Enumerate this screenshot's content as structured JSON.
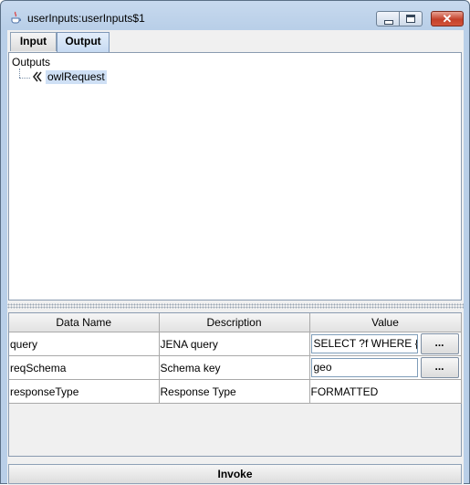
{
  "window": {
    "title": "userInputs:userInputs$1",
    "controls": {
      "minimize_icon": "minimize-icon",
      "maximize_icon": "maximize-icon",
      "close_icon": "close-icon",
      "close_glyph": "✕"
    }
  },
  "tabs": [
    {
      "label": "Input",
      "selected": false
    },
    {
      "label": "Output",
      "selected": true
    }
  ],
  "tree": {
    "root": "Outputs",
    "children": [
      {
        "label": "owlRequest",
        "icon": "service-node-icon",
        "selected": true
      }
    ]
  },
  "table": {
    "columns": [
      "Data Name",
      "Description",
      "Value"
    ],
    "rows": [
      {
        "name": "query",
        "description": "JENA query",
        "value": "SELECT ?f WHERE {",
        "has_button": true,
        "button_label": "..."
      },
      {
        "name": "reqSchema",
        "description": "Schema key",
        "value": "geo",
        "has_button": true,
        "button_label": "..."
      },
      {
        "name": "responseType",
        "description": "Response Type",
        "value": "FORMATTED",
        "has_button": false
      }
    ]
  },
  "invoke_label": "Invoke",
  "colors": {
    "title_bar": "#b9cfe8",
    "selection": "#cfe0f5",
    "close_button": "#c4402a"
  }
}
